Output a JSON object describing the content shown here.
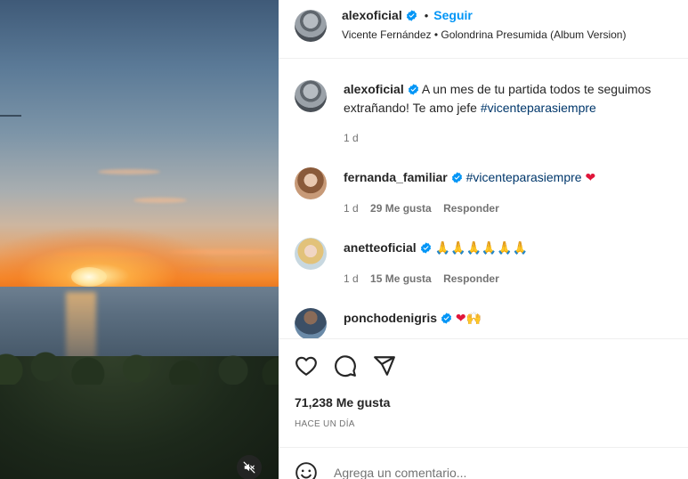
{
  "post": {
    "author": "alexoficial",
    "follow_label": "Seguir",
    "dot": "•",
    "audio": "Vicente Fernández • Golondrina Presumida (Album Version)"
  },
  "caption": {
    "username": "alexoficial",
    "text": "A un mes de tu partida todos te seguimos extrañando! Te amo jefe",
    "hashtag": "#vicenteparasiempre",
    "time": "1 d"
  },
  "comments": [
    {
      "username": "fernanda_familiar",
      "hashtag": "#vicenteparasiempre",
      "emoji": "❤",
      "time": "1 d",
      "likes": "29 Me gusta",
      "reply": "Responder"
    },
    {
      "username": "anetteoficial",
      "emoji": "🙏🙏🙏🙏🙏🙏",
      "time": "1 d",
      "likes": "15 Me gusta",
      "reply": "Responder"
    },
    {
      "username": "ponchodenigris",
      "emoji": "❤🙌"
    }
  ],
  "stats": {
    "likes": "71,238 Me gusta",
    "time_ago": "HACE UN DÍA"
  },
  "comment_box": {
    "placeholder": "Agrega un comentario..."
  },
  "colors": {
    "link": "#0095f6",
    "hashtag": "#00376b",
    "verified": "#0095f6",
    "heart": "#e0163a"
  },
  "icons": {
    "like": "heart-outline-icon",
    "comment": "comment-bubble-icon",
    "share": "paper-plane-icon",
    "mute": "muted-speaker-icon",
    "verified": "verified-badge-icon",
    "emoji": "smiley-face-icon"
  }
}
